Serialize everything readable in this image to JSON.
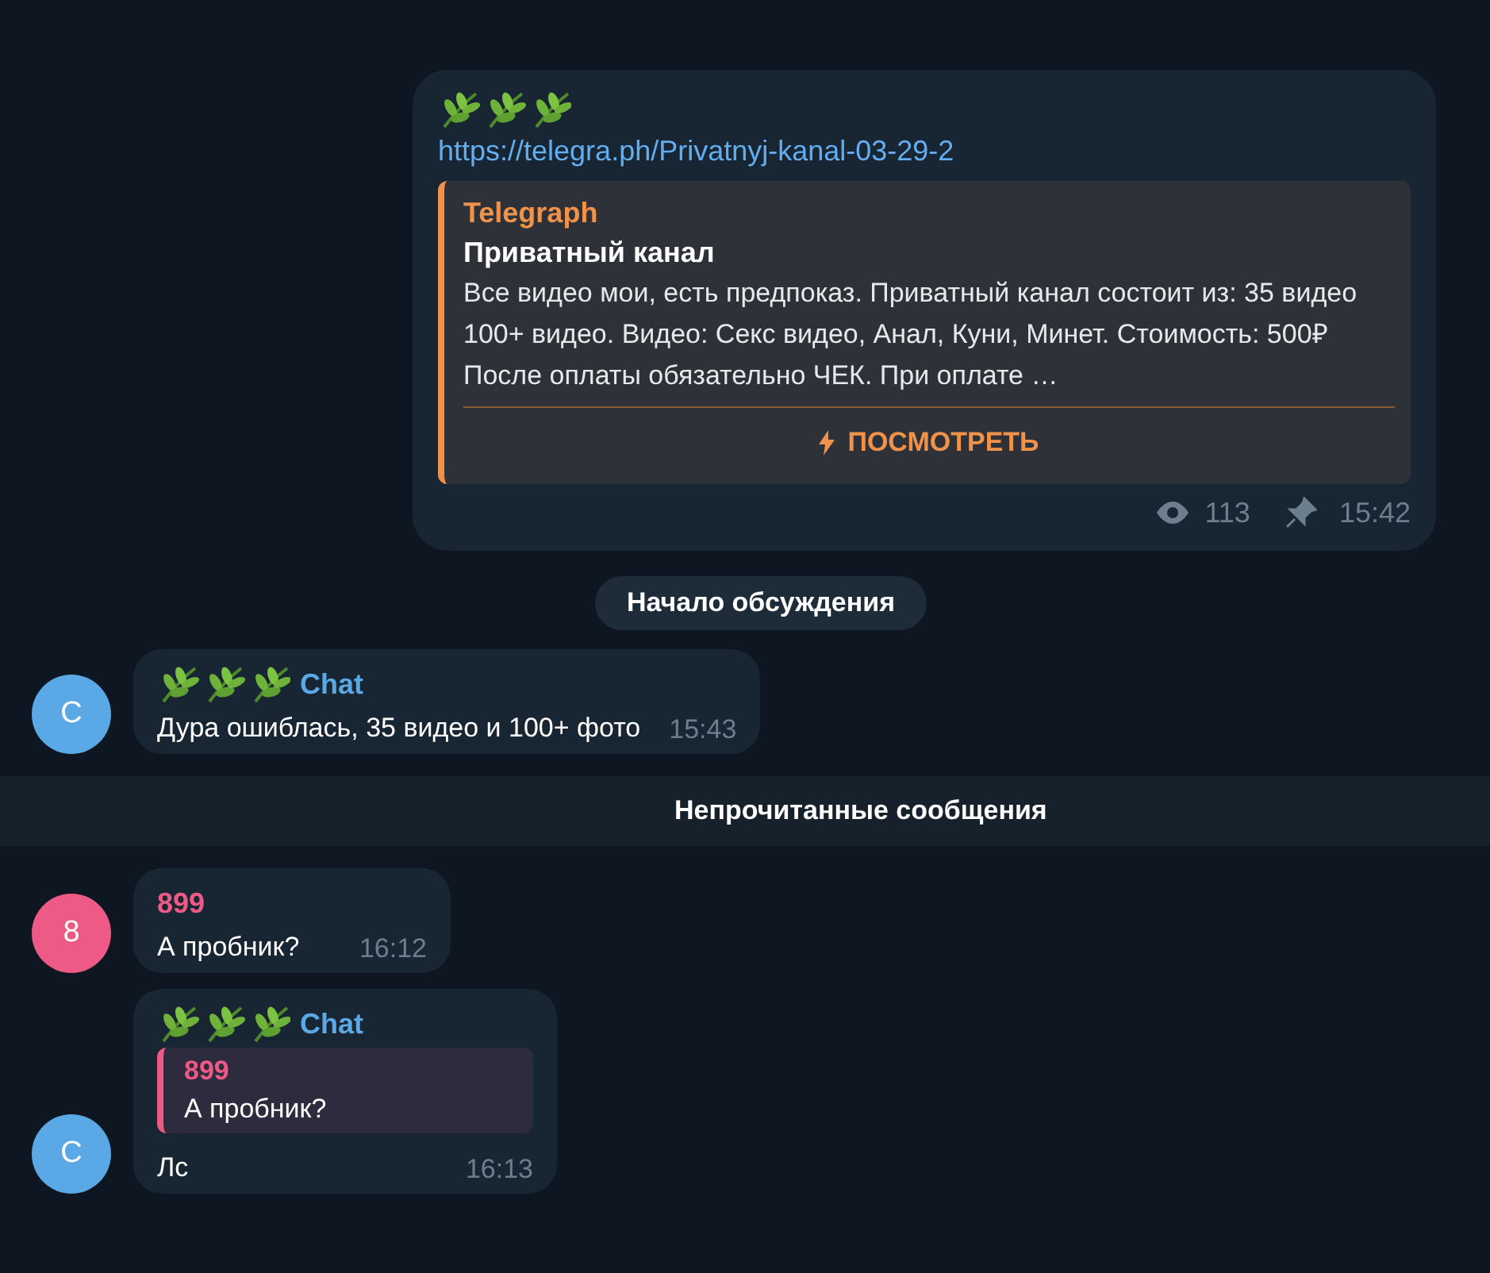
{
  "post": {
    "link": "https://telegra.ph/Privatnyj-kanal-03-29-2",
    "preview": {
      "site": "Telegraph",
      "title": "Приватный канал",
      "description": "Все видео мои, есть предпоказ. Приватный канал состоит из: 35 видео 100+ видео. Видео: Секс видео, Анал, Куни, Минет. Стоимость: 500₽ После оплаты обязательно ЧЕК. При оплате …",
      "button": "ПОСМОТРЕТЬ"
    },
    "views": "113",
    "time": "15:42"
  },
  "service": "Начало обсуждения",
  "feed": [
    {
      "kind": "message",
      "sender": "Chat",
      "leaves": true,
      "avatar": "C",
      "color": "#5aa9e6",
      "text": "Дура ошиблась, 35 видео и 100+ фото",
      "time": "15:43"
    },
    {
      "kind": "divider",
      "text": "Непрочитанные сообщения"
    },
    {
      "kind": "message",
      "sender": "899",
      "leaves": false,
      "avatar": "8",
      "color": "#ee5a86",
      "text": "А пробник?",
      "time": "16:12"
    },
    {
      "kind": "message",
      "sender": "Chat",
      "leaves": true,
      "avatar": "C",
      "color": "#5aa9e6",
      "reply": {
        "sender": "899",
        "color": "#ee5a86",
        "text": "А пробник?"
      },
      "text": "Лс",
      "time": "16:13"
    }
  ]
}
